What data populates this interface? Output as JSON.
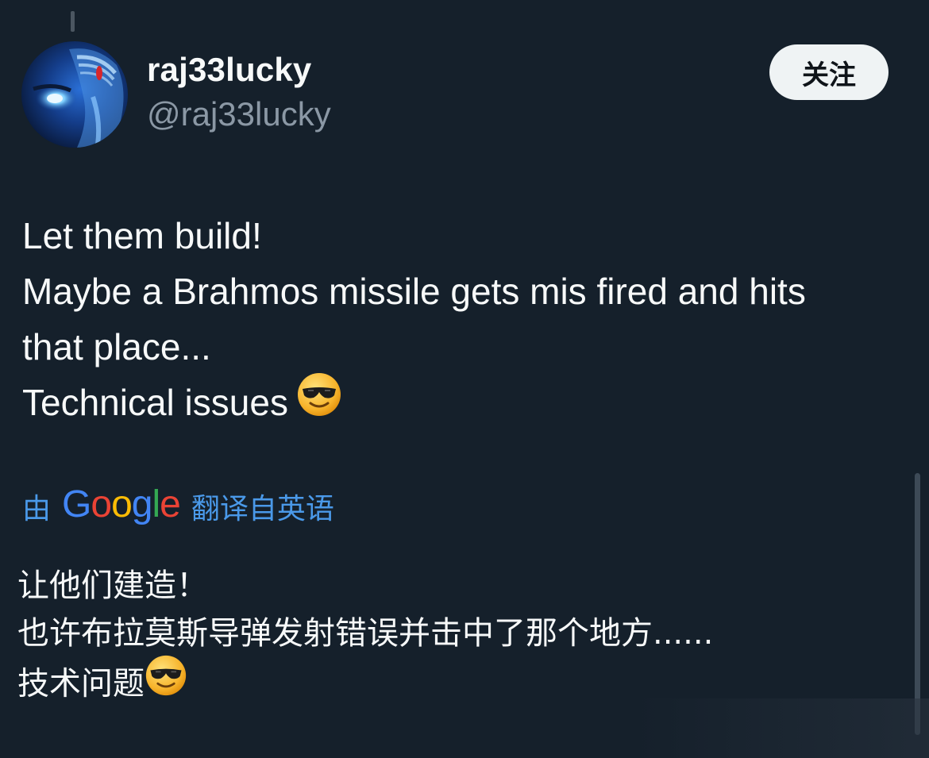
{
  "user": {
    "display_name": "raj33lucky",
    "handle": "@raj33lucky",
    "follow_label": "关注"
  },
  "tweet": {
    "lines": [
      "Let them build!",
      "Maybe a Brahmos missile gets mis fired and hits",
      "that place...",
      "Technical issues"
    ],
    "emoji": "smiling-face-with-sunglasses"
  },
  "translation": {
    "prefix": "由",
    "provider": "Google",
    "suffix": "翻译自英语",
    "lines": [
      "让他们建造！",
      "也许布拉莫斯导弹发射错误并击中了那个地方......",
      "技术问题"
    ],
    "emoji": "smiling-face-with-sunglasses"
  },
  "colors": {
    "background": "#15202b",
    "primary_text": "#f7f9f9",
    "secondary_text": "#8b98a5",
    "link": "#4a99e9",
    "button_bg": "#eff3f4"
  }
}
